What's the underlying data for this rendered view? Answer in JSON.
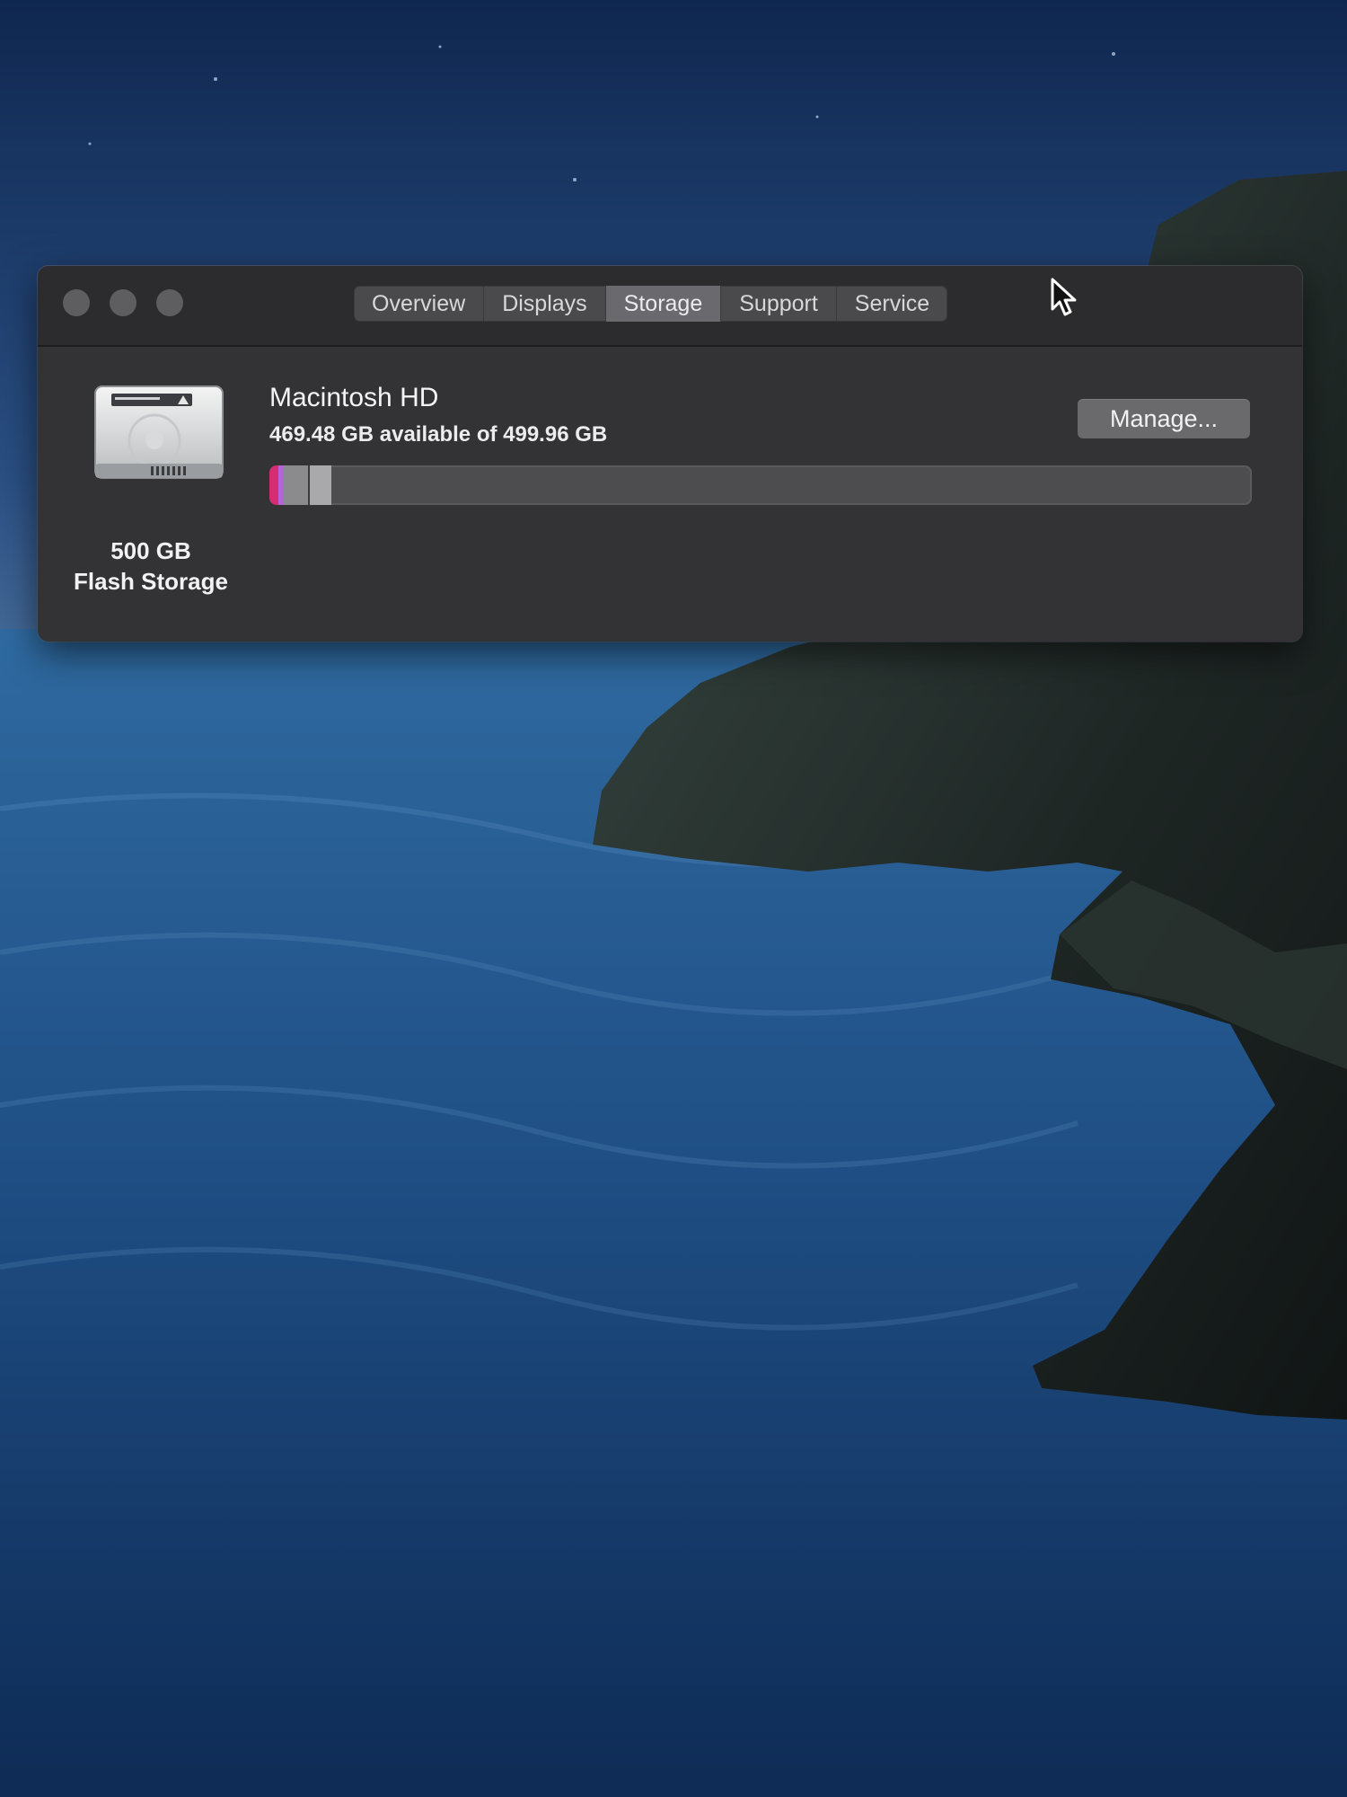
{
  "window": {
    "tabs": [
      {
        "label": "Overview",
        "active": false
      },
      {
        "label": "Displays",
        "active": false
      },
      {
        "label": "Storage",
        "active": true
      },
      {
        "label": "Support",
        "active": false
      },
      {
        "label": "Service",
        "active": false
      }
    ]
  },
  "storage": {
    "disk_size": "500 GB",
    "disk_type": "Flash Storage",
    "volume_name": "Macintosh HD",
    "availability": "469.48 GB available of 499.96 GB",
    "used_fraction": 0.061,
    "manage_label": "Manage..."
  },
  "icons": {
    "disk": "hard-drive-icon",
    "cursor": "mouse-pointer-icon"
  },
  "colors": {
    "window_bg": "#333335",
    "titlebar_bg": "#2c2c2e",
    "active_tab": "#6a6a6e",
    "usage_pink": "#d62c72",
    "usage_purple": "#b463d8"
  }
}
